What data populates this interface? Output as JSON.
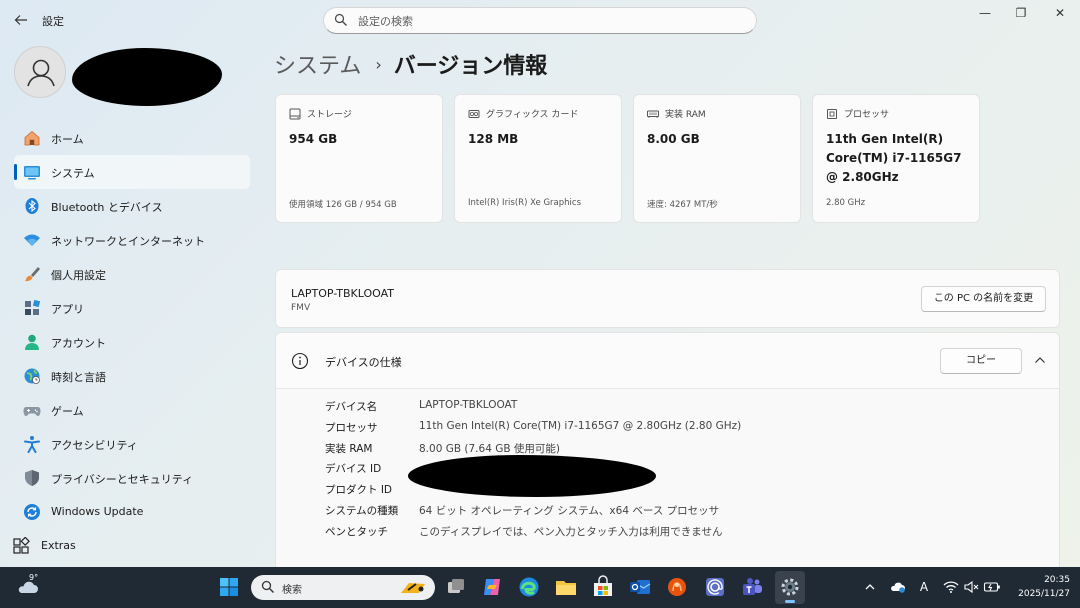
{
  "window": {
    "title": "設定",
    "search_placeholder": "設定の検索",
    "controls": {
      "minimize": "—",
      "maximize": "❐",
      "close": "✕"
    }
  },
  "sidebar": {
    "items": [
      {
        "label": "ホーム",
        "icon": "home-icon"
      },
      {
        "label": "システム",
        "icon": "system-icon",
        "active": true
      },
      {
        "label": "Bluetooth とデバイス",
        "icon": "bluetooth-icon"
      },
      {
        "label": "ネットワークとインターネット",
        "icon": "network-icon"
      },
      {
        "label": "個人用設定",
        "icon": "personalization-icon"
      },
      {
        "label": "アプリ",
        "icon": "apps-icon"
      },
      {
        "label": "アカウント",
        "icon": "account-icon"
      },
      {
        "label": "時刻と言語",
        "icon": "time-language-icon"
      },
      {
        "label": "ゲーム",
        "icon": "gaming-icon"
      },
      {
        "label": "アクセシビリティ",
        "icon": "accessibility-icon"
      },
      {
        "label": "プライバシーとセキュリティ",
        "icon": "privacy-icon"
      },
      {
        "label": "Windows Update",
        "icon": "windows-update-icon"
      },
      {
        "label": "Extras",
        "icon": "extras-icon"
      }
    ]
  },
  "breadcrumb": {
    "parent": "システム",
    "separator": "›",
    "current": "バージョン情報"
  },
  "cards": [
    {
      "label": "ストレージ",
      "value": "954 GB",
      "sub": "使用領域 126 GB / 954 GB",
      "icon": "storage-icon"
    },
    {
      "label": "グラフィックス カード",
      "value": "128 MB",
      "sub": "Intel(R) Iris(R) Xe Graphics",
      "icon": "graphics-card-icon"
    },
    {
      "label": "実装 RAM",
      "value": "8.00 GB",
      "sub": "速度: 4267 MT/秒",
      "icon": "ram-icon"
    },
    {
      "label": "プロセッサ",
      "value": "11th Gen Intel(R) Core(TM) i7-1165G7 @ 2.80GHz",
      "sub": "2.80 GHz",
      "icon": "processor-icon"
    }
  ],
  "pc": {
    "name": "LAPTOP-TBKLOOAT",
    "model": "FMV",
    "rename_button": "この PC の名前を変更"
  },
  "specs": {
    "title": "デバイスの仕様",
    "copy_button": "コピー",
    "rows": [
      {
        "key": "デバイス名",
        "value": "LAPTOP-TBKLOOAT"
      },
      {
        "key": "プロセッサ",
        "value": "11th Gen Intel(R) Core(TM) i7-1165G7 @ 2.80GHz (2.80 GHz)"
      },
      {
        "key": "実装 RAM",
        "value": "8.00 GB (7.64 GB 使用可能)"
      },
      {
        "key": "デバイス ID",
        "value": ""
      },
      {
        "key": "プロダクト ID",
        "value": ""
      },
      {
        "key": "システムの種類",
        "value": "64 ビット オペレーティング システム、x64 ベース プロセッサ"
      },
      {
        "key": "ペンとタッチ",
        "value": "このディスプレイでは、ペン入力とタッチ入力は利用できません"
      }
    ]
  },
  "taskbar": {
    "temperature": "9°",
    "search_label": "検索",
    "time": "20:35",
    "date": "2025/11/27",
    "ime": "A"
  },
  "colors": {
    "accent": "#005fb8",
    "taskbar": "#1f2a35"
  }
}
